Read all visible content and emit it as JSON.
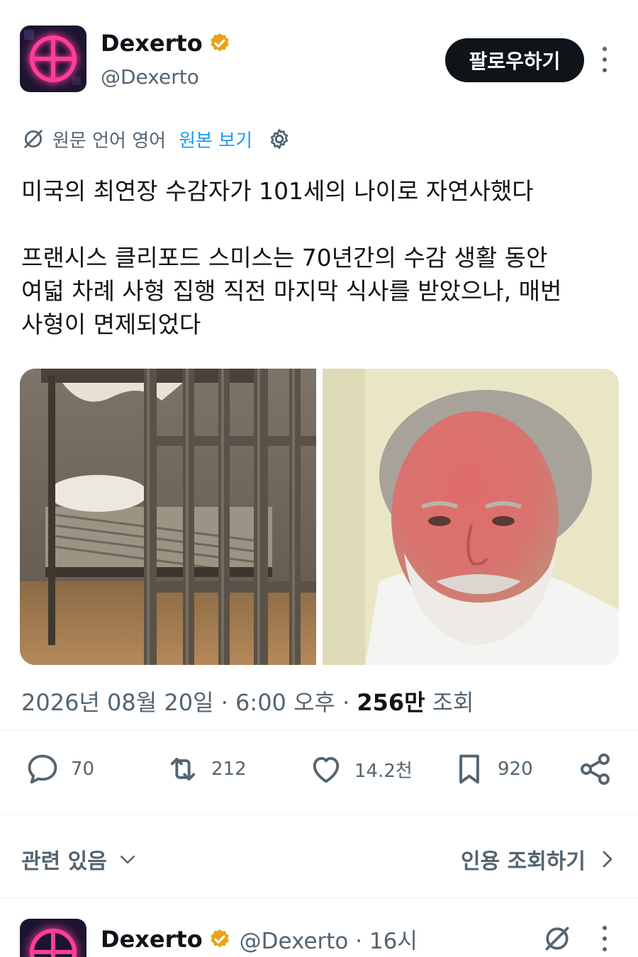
{
  "author": {
    "name": "Dexerto",
    "handle": "@Dexerto",
    "verified_color": "#e8a317"
  },
  "follow_label": "팔로우하기",
  "translation": {
    "note": "원문 언어 영어",
    "link": "원본 보기"
  },
  "tweet": {
    "text": "미국의 최연장 수감자가 101세의 나이로 자연사했다\n\n프랜시스 클리포드 스미스는 70년간의 수감 생활 동안\n여덟 차례 사형 집행 직전 마지막 식사를 받았으나, 매번\n사형이 면제되었다",
    "date": "2026년 08월 20일 · 6:00 오후 ·",
    "views_count": "256만",
    "views_label": "조회"
  },
  "actions": {
    "replies": "70",
    "reposts": "212",
    "likes": "14.2천",
    "bookmarks": "920"
  },
  "related": {
    "left_label": "관련 있음",
    "right_label": "인용 조회하기"
  },
  "next_tweet": {
    "name": "Dexerto",
    "handle_time": "@Dexerto · 16시"
  },
  "colors": {
    "accent": "#1d9bf0",
    "text_primary": "#0f1419",
    "text_secondary": "#536471",
    "avatar_neon": "#ff3d9a"
  }
}
